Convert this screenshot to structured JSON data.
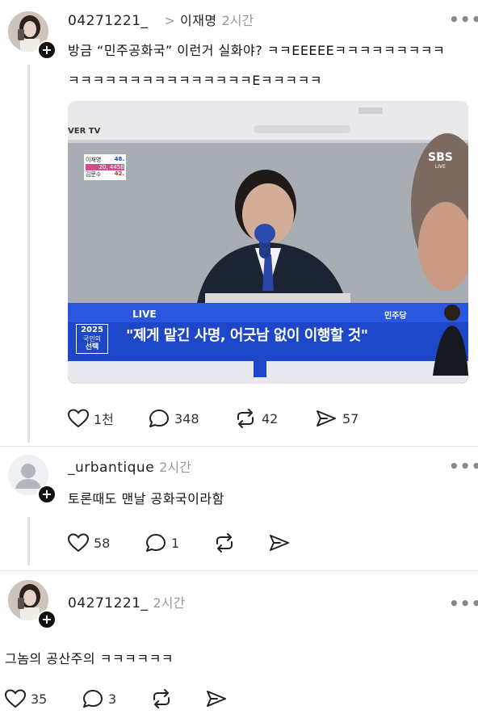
{
  "post": {
    "username": "04271221_",
    "reply_to_arrow": ">",
    "reply_to": "이재명",
    "time": "2시간",
    "text_line1": "방금 “민주공화국” 이런거 실화야? ㅋㅋEEEEEㅋㅋㅋㅋㅋㅋㅋㅋㅋ",
    "text_line2": "ㅋㅋㅋㅋㅋㅋㅋㅋㅋㅋㅋㅋㅋㅋㅋEㅋㅋㅋㅋㅋ",
    "image": {
      "browser_tab": "VER TV",
      "broadcaster": "SBS",
      "broadcaster_sub": "LIVE",
      "live_label": "LIVE",
      "caption": "\"제게 맡긴 사명, 어긋남 없이 이행할 것\"",
      "badge_year": "2025",
      "badge_text1": "국민의",
      "badge_text2": "선택",
      "party_logo": "민주당",
      "score_rows": [
        {
          "name": "이재명",
          "value": "48."
        },
        {
          "name": "",
          "value": "20, 445B"
        },
        {
          "name": "김문수",
          "value": "42."
        }
      ]
    },
    "actions": {
      "likes": "1천",
      "comments": "348",
      "reposts": "42",
      "shares": "57"
    }
  },
  "reply1": {
    "username": "_urbantique",
    "time": "2시간",
    "text": "토론때도 맨날 공화국이라함",
    "actions": {
      "likes": "58",
      "comments": "1"
    }
  },
  "reply2": {
    "username": "04271221_",
    "time": "2시간",
    "text": "그놈의 공산주의 ㅋㅋㅋㅋㅋㅋ",
    "actions": {
      "likes": "35",
      "comments": "3"
    }
  },
  "more_label": "•••"
}
